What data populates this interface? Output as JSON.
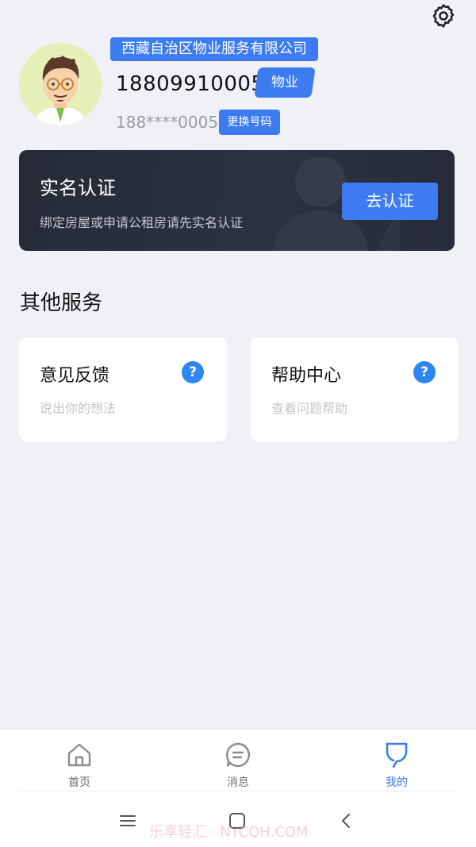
{
  "profile": {
    "organization": "西藏自治区物业服务有限公司",
    "phone": "18809910005",
    "role": "物业",
    "masked_phone": "188****0005",
    "change_number_label": "更换号码"
  },
  "verification": {
    "title": "实名认证",
    "subtitle": "绑定房屋或申请公租房请先实名认证",
    "button_label": "去认证"
  },
  "other_services": {
    "title": "其他服务",
    "items": [
      {
        "title": "意见反馈",
        "subtitle": "说出你的想法",
        "icon": "question-icon",
        "icon_glyph": "?"
      },
      {
        "title": "帮助中心",
        "subtitle": "查看问题帮助",
        "icon": "question-icon",
        "icon_glyph": "?"
      }
    ]
  },
  "tabbar": {
    "items": [
      {
        "label": "首页",
        "icon": "home-icon",
        "active": false
      },
      {
        "label": "消息",
        "icon": "message-icon",
        "active": false
      },
      {
        "label": "我的",
        "icon": "profile-icon",
        "active": true
      }
    ]
  },
  "watermark": "乐享轻汇 · NYCQH.COM",
  "colors": {
    "accent": "#3d7cf0",
    "background": "#f0f1f7",
    "card_dark": "#262b37",
    "question_icon": "#2f86f0"
  }
}
